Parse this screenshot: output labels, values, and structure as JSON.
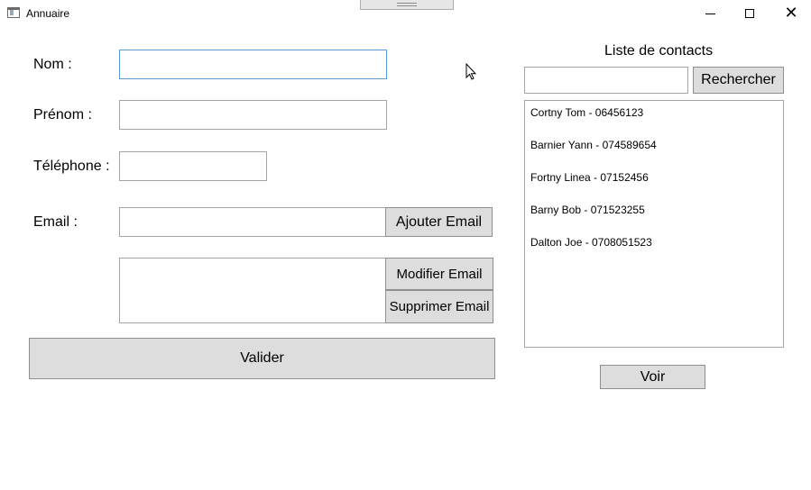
{
  "window": {
    "title": "Annuaire"
  },
  "form": {
    "nom_label": "Nom :",
    "nom_value": "",
    "prenom_label": "Prénom :",
    "prenom_value": "",
    "telephone_label": "Téléphone :",
    "telephone_value": "",
    "email_label": "Email :",
    "email_value": "",
    "add_email": "Ajouter Email",
    "modify_email": "Modifier Email",
    "delete_email": "Supprimer Email",
    "validate": "Valider"
  },
  "contacts": {
    "title": "Liste de contacts",
    "search_value": "",
    "search_button": "Rechercher",
    "items": [
      "Cortny Tom - 06456123",
      "Barnier Yann - 074589654",
      "Fortny Linea - 07152456",
      "Barny Bob - 071523255",
      "Dalton Joe - 0708051523"
    ],
    "view_button": "Voir"
  }
}
